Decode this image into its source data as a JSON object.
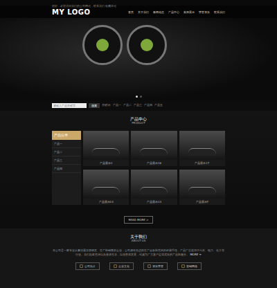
{
  "top_bar": {
    "text": "您好，欢迎访问我们的公司网站，联系我们 收藏本站"
  },
  "header": {
    "logo": "MY LOGO",
    "nav": [
      {
        "label": "首页"
      },
      {
        "label": "关于我们"
      },
      {
        "label": "新闻动态"
      },
      {
        "label": "产品中心"
      },
      {
        "label": "案例展示"
      },
      {
        "label": "荣誉资质"
      },
      {
        "label": "联系我们"
      }
    ]
  },
  "banner": {
    "dots": [
      {
        "selected": true
      },
      {
        "selected": false
      }
    ]
  },
  "search": {
    "placeholder": "请输入产品关键字",
    "button": "搜索",
    "hot_label": "关键词:",
    "hot_words": [
      "产品一",
      "产品二",
      "产品三",
      "产品四",
      "产品五"
    ]
  },
  "products": {
    "title": "产品中心",
    "subtitle": "PRODUCT",
    "categories_title": "产品分类",
    "categories": [
      {
        "label": "产品一"
      },
      {
        "label": "产品二"
      },
      {
        "label": "产品三"
      },
      {
        "label": "产品四"
      }
    ],
    "items": [
      {
        "caption": "产品展示1"
      },
      {
        "caption": "产品展示16"
      },
      {
        "caption": "产品展示17"
      },
      {
        "caption": "产品展示14"
      },
      {
        "caption": "产品展示13"
      },
      {
        "caption": "产品展示7"
      }
    ],
    "more": "READ MORE >"
  },
  "about": {
    "title": "关于我们",
    "subtitle": "ABOUT US",
    "text": "本公司是一家专业从事仪器仪表研发、生产和销售的企业，公司拥有先进的生产设备和完善的检测手段，产品广泛应用于汽车、电力、化工等行业。我们始终坚持以质量求生存，以信誉求发展，竭诚为广大客户提供优质的产品和服务。",
    "more": "MORE +",
    "buttons": [
      {
        "label": "公司简介"
      },
      {
        "label": "企业文化"
      },
      {
        "label": "资质荣誉"
      },
      {
        "label": "营销网络"
      }
    ]
  }
}
